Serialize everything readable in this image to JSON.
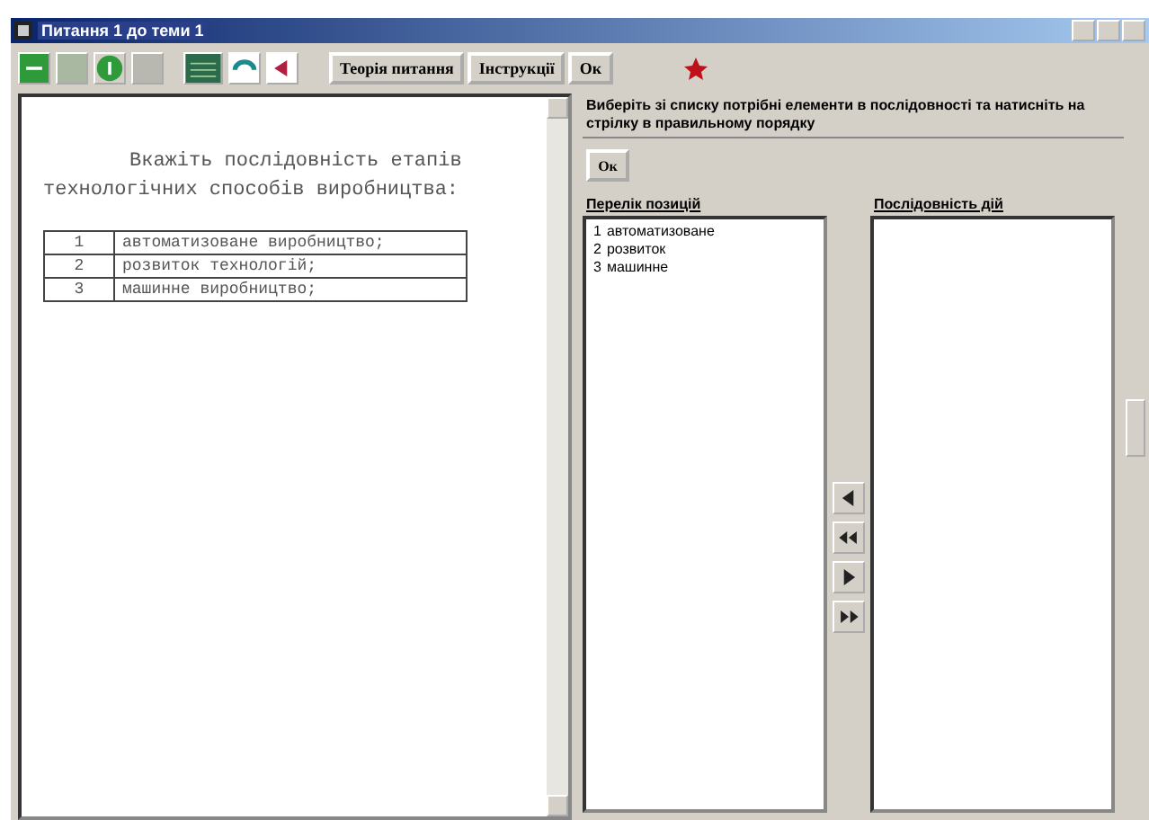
{
  "window": {
    "title": "Питання 1 до теми 1"
  },
  "toolbar": {
    "buttons": [
      "Теорія питання",
      "Інструкції",
      "Ок"
    ]
  },
  "question": {
    "text": "Вкажіть послідовність етапів технологічних способів виробництва:",
    "rows": [
      {
        "number": "1",
        "text": "автоматизоване виробництво;"
      },
      {
        "number": "2",
        "text": "розвиток технологій;"
      },
      {
        "number": "3",
        "text": "машинне виробництво;"
      }
    ]
  },
  "task": {
    "instruction": "Виберіть зі списку потрібні елементи в послідовності та натисніть на стрілку в правильному порядку",
    "ok_button": "Ок",
    "source": {
      "title": "Перелік позицій",
      "items": [
        {
          "number": "1",
          "text": "автоматизоване",
          "selected": false
        },
        {
          "number": "2",
          "text": "розвиток",
          "selected": false
        },
        {
          "number": "3",
          "text": "машинне",
          "selected": false
        }
      ]
    },
    "target": {
      "title": "Послідовність дій"
    }
  }
}
